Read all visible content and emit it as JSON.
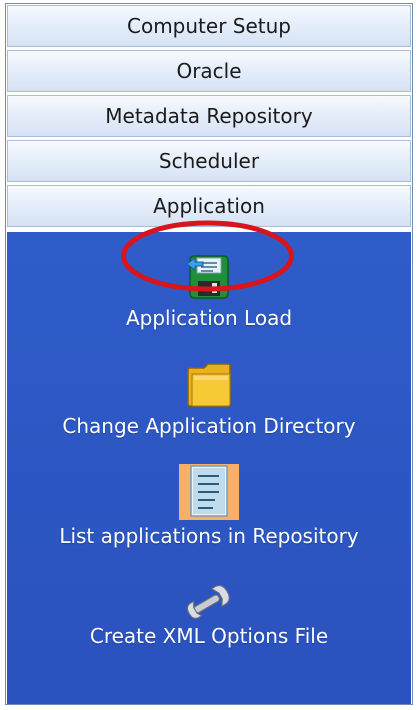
{
  "headers": [
    {
      "label": "Computer Setup"
    },
    {
      "label": "Oracle"
    },
    {
      "label": "Metadata Repository"
    },
    {
      "label": "Scheduler"
    },
    {
      "label": "Application"
    }
  ],
  "tools": [
    {
      "label": "Application Load",
      "icon": "save-load-icon"
    },
    {
      "label": "Change Application Directory",
      "icon": "folder-icon"
    },
    {
      "label": "List applications in Repository",
      "icon": "document-list-icon"
    },
    {
      "label": "Create XML Options File",
      "icon": "wrench-icon"
    }
  ],
  "colors": {
    "content_bg": "#2b56c3",
    "highlight_ring": "#d8141c"
  }
}
